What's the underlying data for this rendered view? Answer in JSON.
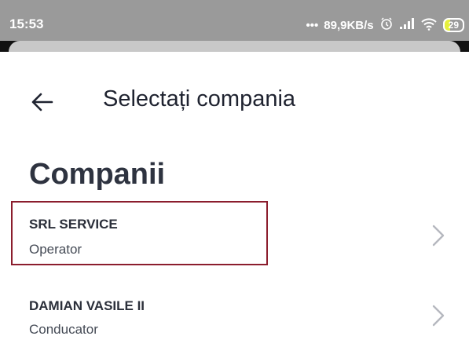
{
  "status_bar": {
    "time": "15:53",
    "network_speed": "89,9KB/s",
    "battery_level": "29",
    "icons": [
      "alarm-icon",
      "signal-icon",
      "wifi-icon",
      "battery-icon"
    ]
  },
  "header": {
    "back_icon": "arrow-left-icon",
    "title": "Selectați compania"
  },
  "section": {
    "title": "Companii"
  },
  "companies": [
    {
      "name": "SRL SERVICE",
      "role": "Operator",
      "highlighted": true
    },
    {
      "name": "DAMIAN VASILE II",
      "role": "Conducator",
      "highlighted": false
    }
  ],
  "colors": {
    "status_bar_bg": "#9a9a9a",
    "highlight_border": "#8b1d2d",
    "title_text": "#1f2330",
    "chevron": "#b5b8bf"
  }
}
